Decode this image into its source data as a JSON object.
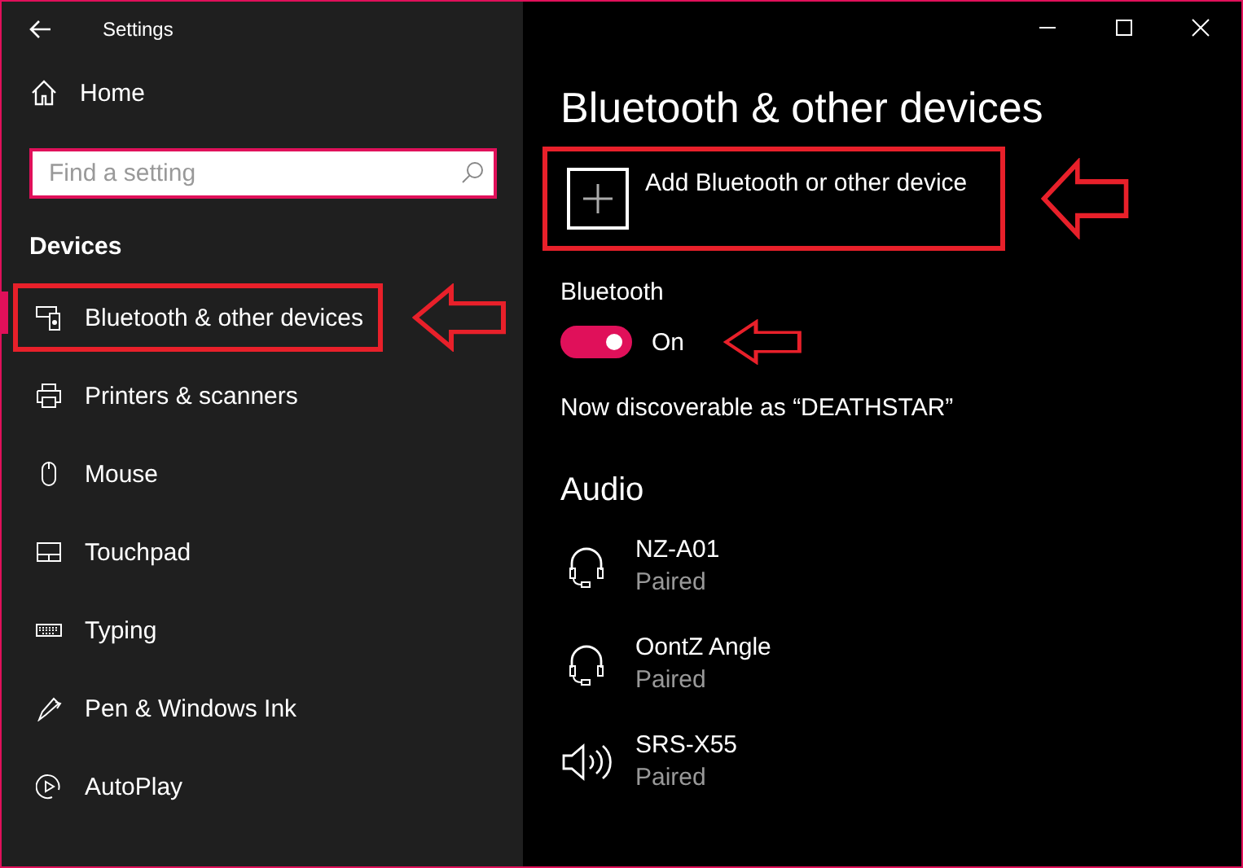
{
  "window": {
    "title": "Settings"
  },
  "sidebar": {
    "home": "Home",
    "search": {
      "placeholder": "Find a setting"
    },
    "section": "Devices",
    "items": [
      {
        "label": "Bluetooth & other devices",
        "selected": true,
        "annotated": true
      },
      {
        "label": "Printers & scanners",
        "selected": false,
        "annotated": false
      },
      {
        "label": "Mouse",
        "selected": false,
        "annotated": false
      },
      {
        "label": "Touchpad",
        "selected": false,
        "annotated": false
      },
      {
        "label": "Typing",
        "selected": false,
        "annotated": false
      },
      {
        "label": "Pen & Windows Ink",
        "selected": false,
        "annotated": false
      },
      {
        "label": "AutoPlay",
        "selected": false,
        "annotated": false
      }
    ]
  },
  "main": {
    "title": "Bluetooth & other devices",
    "add_device": {
      "label": "Add Bluetooth or other device",
      "annotated": true
    },
    "bluetooth": {
      "label": "Bluetooth",
      "on": true,
      "state_text": "On",
      "annotated": true
    },
    "discoverable": "Now discoverable as “DEATHSTAR”",
    "audio": {
      "heading": "Audio",
      "devices": [
        {
          "name": "NZ-A01",
          "status": "Paired",
          "kind": "headset"
        },
        {
          "name": "OontZ Angle",
          "status": "Paired",
          "kind": "headset"
        },
        {
          "name": "SRS-X55",
          "status": "Paired",
          "kind": "speaker"
        }
      ]
    }
  }
}
